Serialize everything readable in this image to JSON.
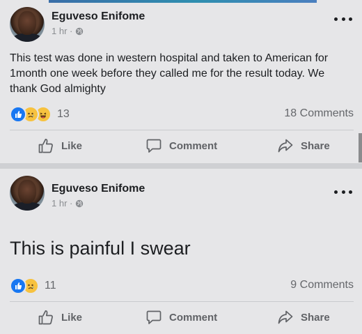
{
  "posts": [
    {
      "author": "Eguveso Enifome",
      "time": "1 hr ·",
      "text": "This test was done in western hospital and taken to American for 1month one week before they called me for the result today. We thank God almighty",
      "reaction_count": "13",
      "reactions": [
        "like",
        "sad",
        "haha"
      ],
      "comments": "18 Comments",
      "actions": {
        "like": "Like",
        "comment": "Comment",
        "share": "Share"
      }
    },
    {
      "author": "Eguveso Enifome",
      "time": "1 hr ·",
      "text": "This is painful I swear",
      "reaction_count": "11",
      "reactions": [
        "like",
        "sad"
      ],
      "comments": "9 Comments",
      "actions": {
        "like": "Like",
        "comment": "Comment",
        "share": "Share"
      }
    }
  ],
  "colors": {
    "like_blue": "#1877f2",
    "emoji_yellow": "#f7c23f",
    "muted_text": "#65676b",
    "background": "#e6e6e8"
  }
}
